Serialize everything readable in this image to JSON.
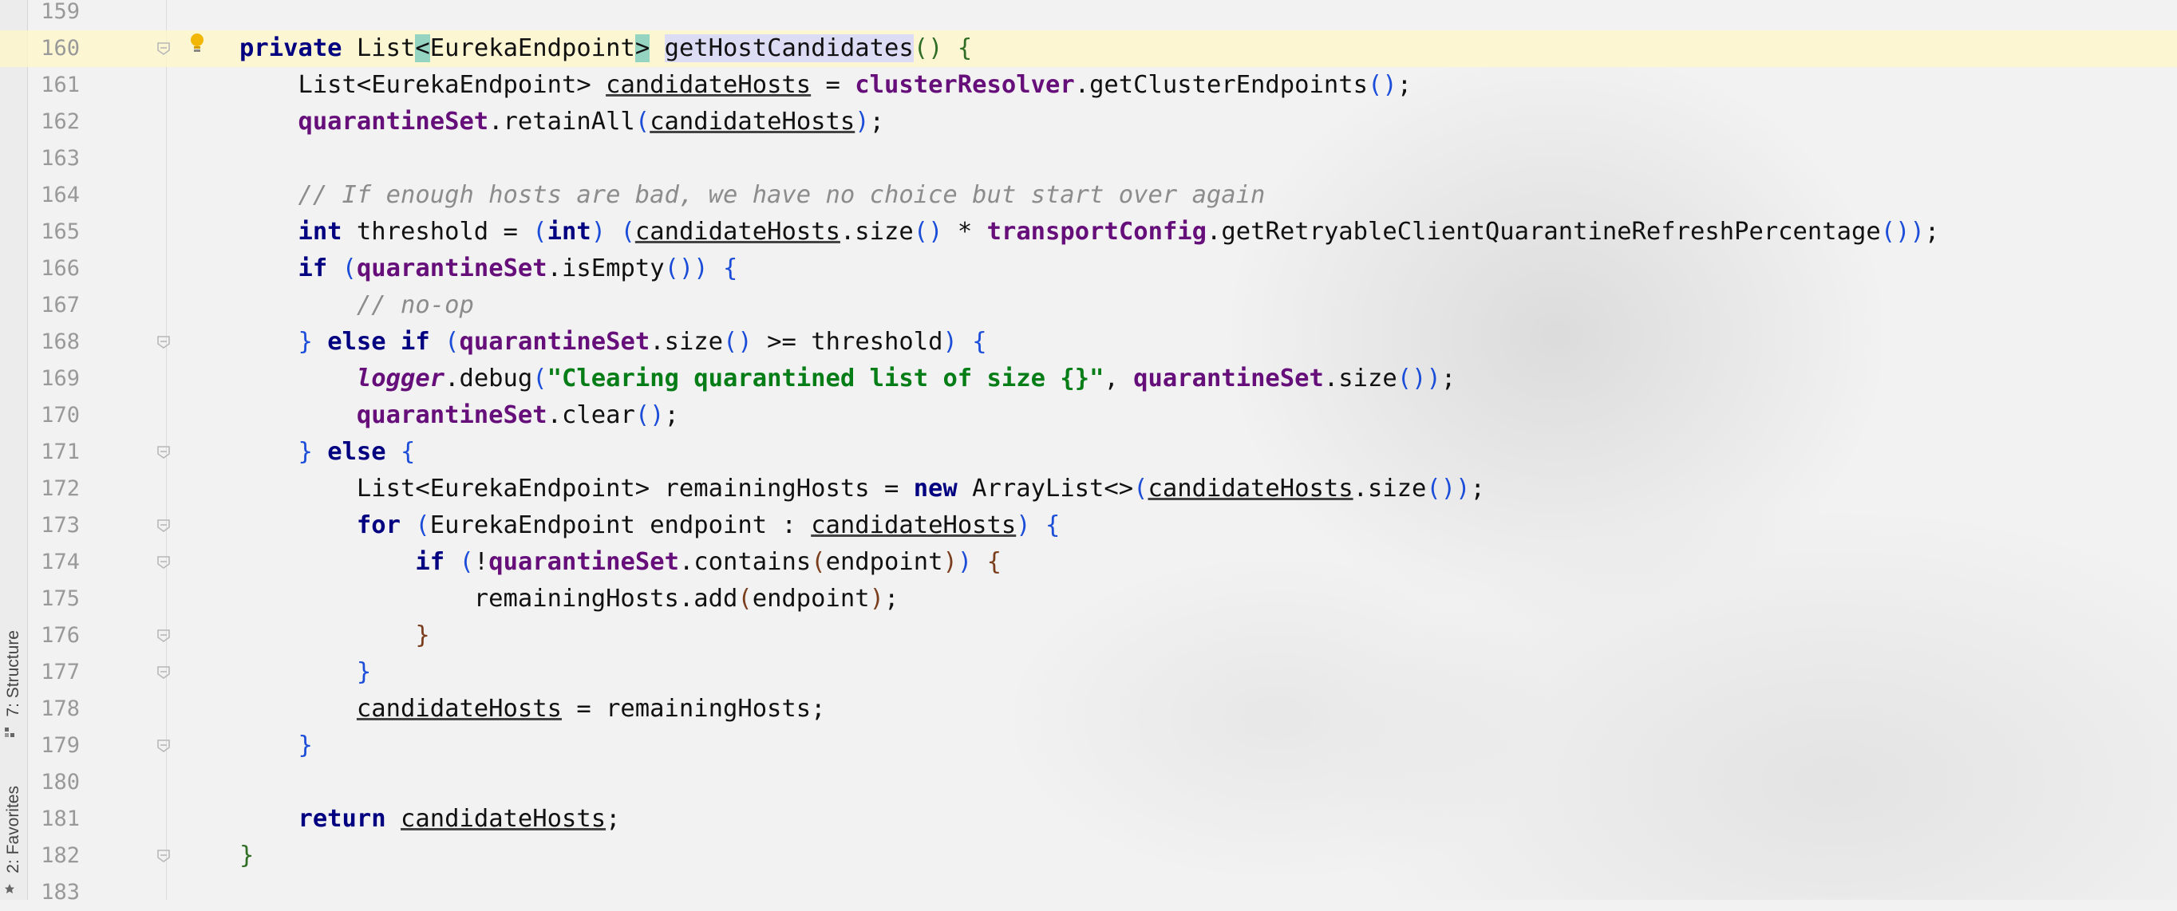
{
  "tool_windows": {
    "structure_label": "7: Structure",
    "favorites_label": "2: Favorites"
  },
  "editor": {
    "lines": [
      {
        "no": "159",
        "fold": false,
        "segments": []
      },
      {
        "no": "160",
        "fold": true,
        "current": true,
        "bulb": true,
        "segments": [
          {
            "t": "private",
            "c": "kw"
          },
          {
            "t": " List"
          },
          {
            "t": "<",
            "c": "brace-hl"
          },
          {
            "t": "EurekaEndpoint"
          },
          {
            "t": ">",
            "c": "brace-hl"
          },
          {
            "t": " "
          },
          {
            "caret": true
          },
          {
            "t": "getHostCandidates",
            "c": "ident-hl"
          },
          {
            "t": "()",
            "c": "p3"
          },
          {
            "t": " "
          },
          {
            "t": "{",
            "c": "p3"
          }
        ]
      },
      {
        "no": "161",
        "segments": [
          {
            "t": "    List<EurekaEndpoint> "
          },
          {
            "t": "candidateHosts",
            "c": "ul"
          },
          {
            "t": " = "
          },
          {
            "t": "clusterResolver",
            "c": "fld"
          },
          {
            "t": ".getClusterEndpoints"
          },
          {
            "t": "()",
            "c": "p1"
          },
          {
            "t": ";"
          }
        ]
      },
      {
        "no": "162",
        "segments": [
          {
            "t": "    "
          },
          {
            "t": "quarantineSet",
            "c": "fld"
          },
          {
            "t": ".retainAll"
          },
          {
            "t": "(",
            "c": "p1"
          },
          {
            "t": "candidateHosts",
            "c": "ul"
          },
          {
            "t": ")",
            "c": "p1"
          },
          {
            "t": ";"
          }
        ]
      },
      {
        "no": "163",
        "segments": []
      },
      {
        "no": "164",
        "segments": [
          {
            "t": "    "
          },
          {
            "t": "// If enough hosts are bad, we have no choice but start over again",
            "c": "cmt"
          }
        ]
      },
      {
        "no": "165",
        "segments": [
          {
            "t": "    "
          },
          {
            "t": "int",
            "c": "kw"
          },
          {
            "t": " threshold = "
          },
          {
            "t": "(",
            "c": "p1"
          },
          {
            "t": "int",
            "c": "kw"
          },
          {
            "t": ")",
            "c": "p1"
          },
          {
            "t": " "
          },
          {
            "t": "(",
            "c": "p1"
          },
          {
            "t": "candidateHosts",
            "c": "ul"
          },
          {
            "t": ".size"
          },
          {
            "t": "()",
            "c": "p1"
          },
          {
            "t": " * "
          },
          {
            "t": "transportConfig",
            "c": "fld"
          },
          {
            "t": ".getRetryableClientQuarantineRefreshPercentage"
          },
          {
            "t": "()",
            "c": "p1"
          },
          {
            "t": ")",
            "c": "p1"
          },
          {
            "t": ";"
          }
        ]
      },
      {
        "no": "166",
        "segments": [
          {
            "t": "    "
          },
          {
            "t": "if",
            "c": "kw"
          },
          {
            "t": " "
          },
          {
            "t": "(",
            "c": "p1"
          },
          {
            "t": "quarantineSet",
            "c": "fld"
          },
          {
            "t": ".isEmpty"
          },
          {
            "t": "()",
            "c": "p1"
          },
          {
            "t": ")",
            "c": "p1"
          },
          {
            "t": " "
          },
          {
            "t": "{",
            "c": "p1"
          }
        ]
      },
      {
        "no": "167",
        "segments": [
          {
            "t": "        "
          },
          {
            "t": "// no-op",
            "c": "cmt"
          }
        ]
      },
      {
        "no": "168",
        "fold": true,
        "segments": [
          {
            "t": "    "
          },
          {
            "t": "}",
            "c": "p1"
          },
          {
            "t": " "
          },
          {
            "t": "else if",
            "c": "kw"
          },
          {
            "t": " "
          },
          {
            "t": "(",
            "c": "p1"
          },
          {
            "t": "quarantineSet",
            "c": "fld"
          },
          {
            "t": ".size"
          },
          {
            "t": "()",
            "c": "p1"
          },
          {
            "t": " >= threshold"
          },
          {
            "t": ")",
            "c": "p1"
          },
          {
            "t": " "
          },
          {
            "t": "{",
            "c": "p1"
          }
        ]
      },
      {
        "no": "169",
        "segments": [
          {
            "t": "        "
          },
          {
            "t": "logger",
            "c": "stat"
          },
          {
            "t": ".debug"
          },
          {
            "t": "(",
            "c": "p1"
          },
          {
            "t": "\"Clearing quarantined list of size {}\"",
            "c": "str"
          },
          {
            "t": ", "
          },
          {
            "t": "quarantineSet",
            "c": "fld"
          },
          {
            "t": ".size"
          },
          {
            "t": "()",
            "c": "p1"
          },
          {
            "t": ")",
            "c": "p1"
          },
          {
            "t": ";"
          }
        ]
      },
      {
        "no": "170",
        "segments": [
          {
            "t": "        "
          },
          {
            "t": "quarantineSet",
            "c": "fld"
          },
          {
            "t": ".clear"
          },
          {
            "t": "()",
            "c": "p1"
          },
          {
            "t": ";"
          }
        ]
      },
      {
        "no": "171",
        "fold": true,
        "segments": [
          {
            "t": "    "
          },
          {
            "t": "}",
            "c": "p1"
          },
          {
            "t": " "
          },
          {
            "t": "else",
            "c": "kw"
          },
          {
            "t": " "
          },
          {
            "t": "{",
            "c": "p1"
          }
        ]
      },
      {
        "no": "172",
        "segments": [
          {
            "t": "        List<EurekaEndpoint> remainingHosts = "
          },
          {
            "t": "new",
            "c": "kw"
          },
          {
            "t": " ArrayList<>"
          },
          {
            "t": "(",
            "c": "p1"
          },
          {
            "t": "candidateHosts",
            "c": "ul"
          },
          {
            "t": ".size"
          },
          {
            "t": "()",
            "c": "p1"
          },
          {
            "t": ")",
            "c": "p1"
          },
          {
            "t": ";"
          }
        ]
      },
      {
        "no": "173",
        "fold": true,
        "segments": [
          {
            "t": "        "
          },
          {
            "t": "for",
            "c": "kw"
          },
          {
            "t": " "
          },
          {
            "t": "(",
            "c": "p1"
          },
          {
            "t": "EurekaEndpoint endpoint : "
          },
          {
            "t": "candidateHosts",
            "c": "ul"
          },
          {
            "t": ")",
            "c": "p1"
          },
          {
            "t": " "
          },
          {
            "t": "{",
            "c": "p1"
          }
        ]
      },
      {
        "no": "174",
        "fold": true,
        "segments": [
          {
            "t": "            "
          },
          {
            "t": "if",
            "c": "kw"
          },
          {
            "t": " "
          },
          {
            "t": "(",
            "c": "p1"
          },
          {
            "t": "!"
          },
          {
            "t": "quarantineSet",
            "c": "fld"
          },
          {
            "t": ".contains"
          },
          {
            "t": "(",
            "c": "p2"
          },
          {
            "t": "endpoint"
          },
          {
            "t": ")",
            "c": "p2"
          },
          {
            "t": ")",
            "c": "p1"
          },
          {
            "t": " "
          },
          {
            "t": "{",
            "c": "p2"
          }
        ]
      },
      {
        "no": "175",
        "segments": [
          {
            "t": "                remainingHosts.add"
          },
          {
            "t": "(",
            "c": "p2"
          },
          {
            "t": "endpoint"
          },
          {
            "t": ")",
            "c": "p2"
          },
          {
            "t": ";"
          }
        ]
      },
      {
        "no": "176",
        "fold": true,
        "segments": [
          {
            "t": "            "
          },
          {
            "t": "}",
            "c": "p2"
          }
        ]
      },
      {
        "no": "177",
        "fold": true,
        "segments": [
          {
            "t": "        "
          },
          {
            "t": "}",
            "c": "p1"
          }
        ]
      },
      {
        "no": "178",
        "segments": [
          {
            "t": "        "
          },
          {
            "t": "candidateHosts",
            "c": "ul"
          },
          {
            "t": " = remainingHosts;"
          }
        ]
      },
      {
        "no": "179",
        "fold": true,
        "segments": [
          {
            "t": "    "
          },
          {
            "t": "}",
            "c": "p1"
          }
        ]
      },
      {
        "no": "180",
        "segments": []
      },
      {
        "no": "181",
        "segments": [
          {
            "t": "    "
          },
          {
            "t": "return",
            "c": "kw"
          },
          {
            "t": " "
          },
          {
            "t": "candidateHosts",
            "c": "ul"
          },
          {
            "t": ";"
          }
        ]
      },
      {
        "no": "182",
        "fold": true,
        "segments": [
          {
            "t": "}",
            "c": "p3"
          }
        ]
      },
      {
        "no": "183",
        "segments": []
      }
    ]
  }
}
